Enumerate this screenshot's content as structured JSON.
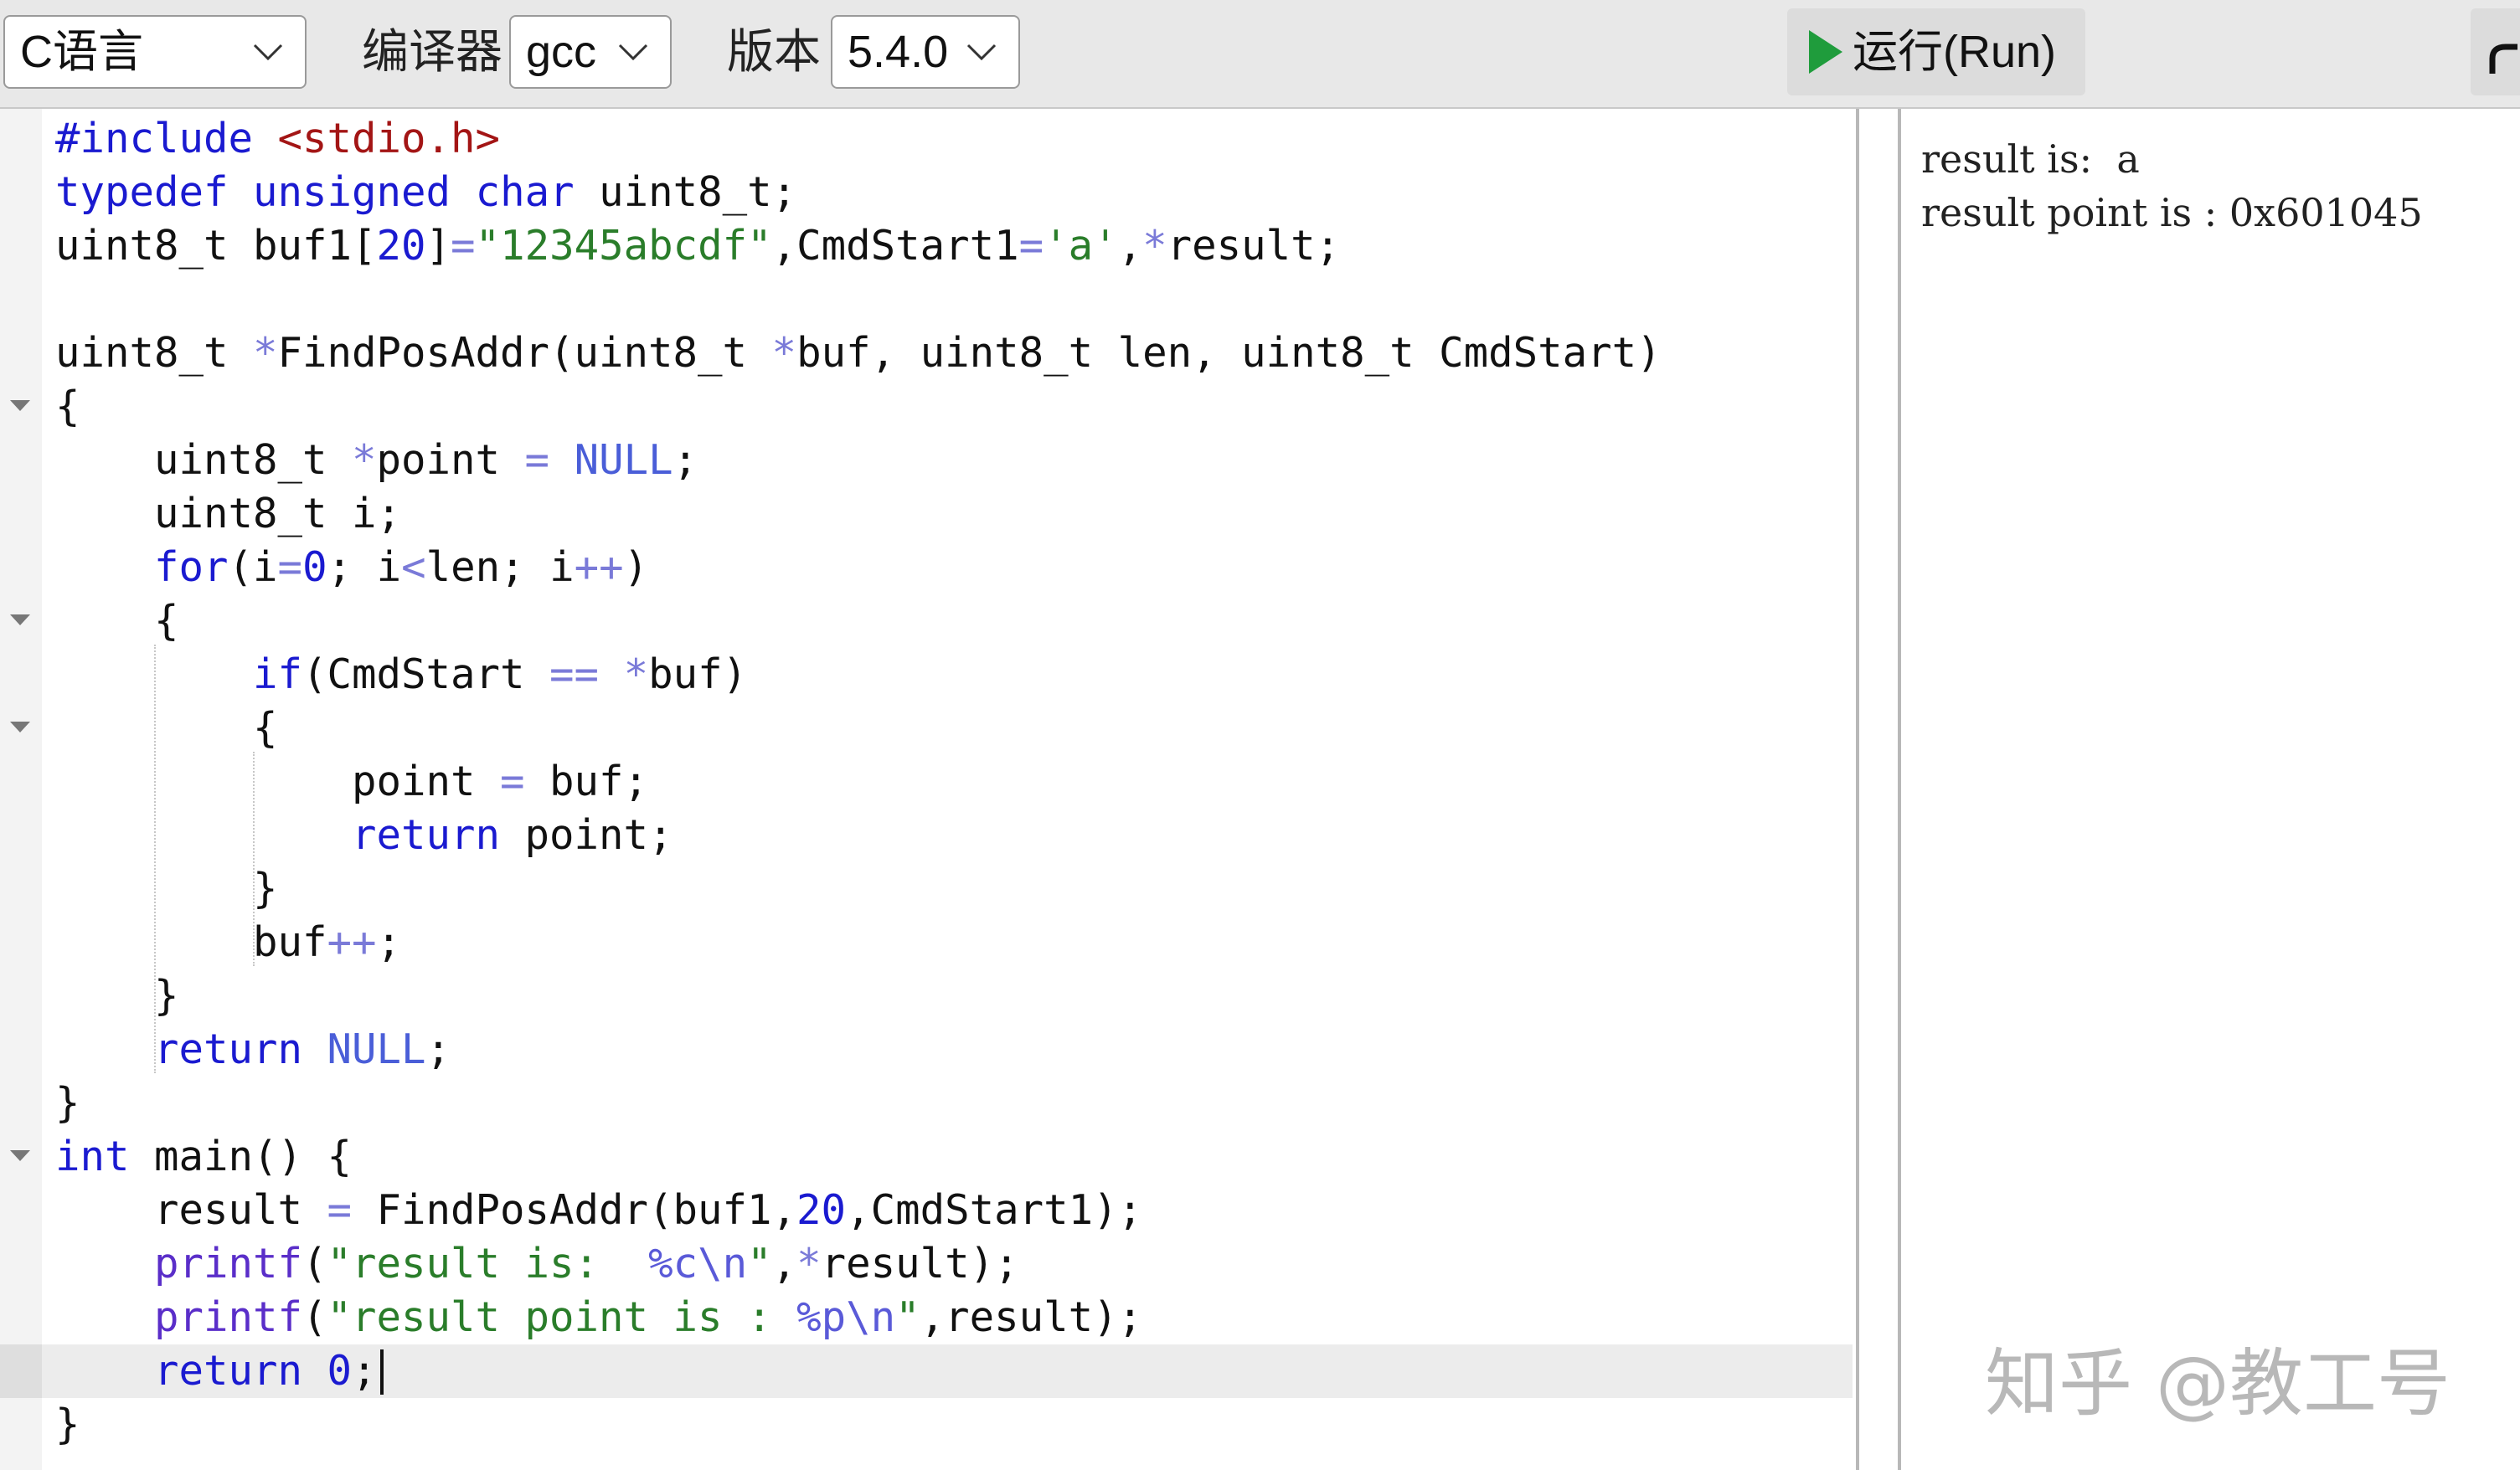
{
  "toolbar": {
    "language_select": "C语言",
    "compiler_label": "编译器",
    "compiler_select": "gcc",
    "version_label": "版本",
    "version_select": "5.4.0",
    "run_label": "运行(Run)"
  },
  "editor": {
    "lines": [
      "#include <stdio.h>",
      "typedef unsigned char uint8_t;",
      "uint8_t buf1[20]=\"12345abcdf\",CmdStart1='a',*result;",
      "",
      "uint8_t *FindPosAddr(uint8_t *buf, uint8_t len, uint8_t CmdStart)",
      "{",
      "    uint8_t *point = NULL;",
      "    uint8_t i;",
      "    for(i=0; i<len; i++)",
      "    {",
      "        if(CmdStart == *buf)",
      "        {",
      "            point = buf;",
      "            return point;",
      "        }",
      "        buf++;",
      "    }",
      "    return NULL;",
      "}",
      "int main() {",
      "    result = FindPosAddr(buf1,20,CmdStart1);",
      "    printf(\"result is:  %c\\n\",*result);",
      "    printf(\"result point is : %p\\n\",result);",
      "    return 0;",
      "}"
    ]
  },
  "output": {
    "lines": [
      "result is:  a",
      "result point is : 0x601045"
    ]
  },
  "watermark": "知乎 @教工号",
  "colors": {
    "keyword": "#1a1ad0",
    "string": "#2a7d2a",
    "header": "#a31515",
    "run_icon": "#1f9c3c"
  }
}
